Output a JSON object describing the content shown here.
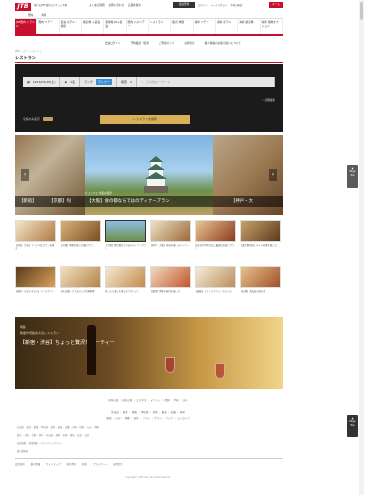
{
  "header": {
    "logo": "JTB",
    "tagline": "旅行のJTB 旅行のチケット予約",
    "top_links": [
      "よくある質問",
      "お問い合わせ",
      "店舗を探す"
    ],
    "member_button": "会員登録",
    "right_links": [
      "ログイン",
      "メールマガジン",
      "予約の確認"
    ],
    "red_button": "ホーム",
    "subhead": [
      "国内",
      "海外"
    ]
  },
  "nav": [
    "JTB国内 トラベル",
    "国内 ツアー",
    "宿泊 ホテル・旅館",
    "航空券 ＋宿泊",
    "新幹線 JR＋宿泊",
    "国内 バスツアー",
    "レストラン",
    "観光 体験",
    "海外 ツアー",
    "海外 ホテル",
    "海外 航空券",
    "海外 現地オプション"
  ],
  "subnav": [
    "会員ログイン",
    "予約確認・取消",
    "ご利用ガイド",
    "お問合せ",
    "個人情報のお取り扱いについて"
  ],
  "breadcrumb": "JTBトップ ＞ レストラン",
  "page_title": "レストラン",
  "search": {
    "date": "2016/03/26(土)",
    "people": "2名",
    "time": "ランチ",
    "time_highlight": "ディナー",
    "area": "関西",
    "keyword_placeholder": "その他キーワード",
    "advanced": "詳細検索",
    "checkbox_label": "空席のみ表示",
    "search_button": "レストランを検索"
  },
  "slider": {
    "small_caption": "ビュッフェ 大阪の夜景",
    "captions": [
      "【新宿】",
      "【京都】旬",
      "【大阪】食の都ならではのディナープラン",
      "【神戸・大"
    ]
  },
  "thumbs": [
    "【新宿・渋谷】ランチ人気プランを選ぶ",
    "【京都】季節を愉しむ懐石プラン",
    "【大阪】食の都ならではのディナープラン",
    "【神戸・大阪】夜景を楽しむディナー",
    "記念日や特別な日に最適なお祝いプラン",
    "【東京駅周辺】ホテル和食を愉しむ",
    "【横浜・みなとみらい】ランチプラン",
    "【名古屋】ひつまぶしと名物料理",
    "ゆったり楽しむ夏のビアガーデン",
    "【福岡】博多の屋台を楽しむ",
    "【銀座】フレンチとワインのコース",
    "【札幌】北海道の海の幸"
  ],
  "banner": {
    "line1": "特集",
    "line2": "新宿や渋谷の人気レストラン",
    "line3": "【新宿・渋谷】ちょっと贅沢なパーティー"
  },
  "footer": {
    "links_1": "日本の旅 ｜ 海外の旅 ｜ ビジネス ｜ イベント ｜ 団体 ｜ 学校 ｜ 法人",
    "links_2": "北海道 ・ 東北 ・ 関東 ・ 甲信越 ・ 北陸 ・ 東海 ・ 近畿 ・ 中国",
    "links_3": "四国 ・ 九州 ・ 沖縄 ・ 海外 ・ ハワイ ・ グアム ・ アジア ・ ヨーロッパ",
    "small_a": "・北海道 ・東北 ・関東 ・甲信越 ・北陸 ・東海 ・近畿 ・中国 ・四国 ・九州 ・沖縄",
    "small_b": "・東京 ・大阪 ・京都 ・神戸 ・名古屋 ・福岡 ・札幌 ・横浜 ・仙台 ・広島",
    "small_c": "・会社概要 ・採用情報 ・プライバシーポリシー",
    "small_d": "・旅行業約款",
    "bar": [
      "会社案内",
      "個人情報",
      "サイトマップ",
      "旅行条件",
      "約款",
      "プライバシー",
      "お問合せ"
    ],
    "copyright": "Copyright © JTB Corp. All rights reserved."
  },
  "side_tabs": [
    "Page Top",
    "Page Top"
  ]
}
